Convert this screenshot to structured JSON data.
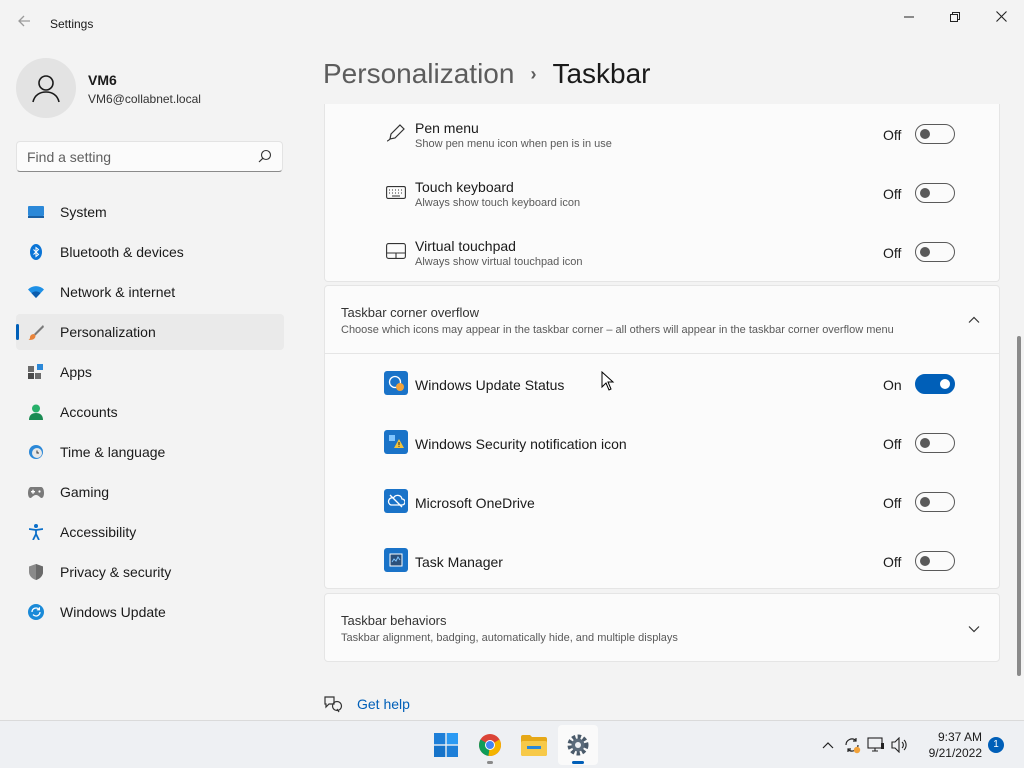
{
  "window": {
    "title": "Settings",
    "back_icon": "back-arrow-icon",
    "controls": [
      "minimize",
      "maximize",
      "close"
    ]
  },
  "profile": {
    "name": "VM6",
    "email": "VM6@collabnet.local"
  },
  "search": {
    "placeholder": "Find a setting"
  },
  "sidebar": {
    "items": [
      {
        "label": "System",
        "icon": "system-icon"
      },
      {
        "label": "Bluetooth & devices",
        "icon": "bluetooth-icon"
      },
      {
        "label": "Network & internet",
        "icon": "network-icon"
      },
      {
        "label": "Personalization",
        "icon": "personalization-icon",
        "selected": true
      },
      {
        "label": "Apps",
        "icon": "apps-icon"
      },
      {
        "label": "Accounts",
        "icon": "accounts-icon"
      },
      {
        "label": "Time & language",
        "icon": "time-language-icon"
      },
      {
        "label": "Gaming",
        "icon": "gaming-icon"
      },
      {
        "label": "Accessibility",
        "icon": "accessibility-icon"
      },
      {
        "label": "Privacy & security",
        "icon": "privacy-icon"
      },
      {
        "label": "Windows Update",
        "icon": "windows-update-icon"
      }
    ]
  },
  "breadcrumb": {
    "parent": "Personalization",
    "separator": "›",
    "current": "Taskbar"
  },
  "corner_icons": {
    "rows": [
      {
        "title": "Pen menu",
        "desc": "Show pen menu icon when pen is in use",
        "state": "Off",
        "on": false
      },
      {
        "title": "Touch keyboard",
        "desc": "Always show touch keyboard icon",
        "state": "Off",
        "on": false
      },
      {
        "title": "Virtual touchpad",
        "desc": "Always show virtual touchpad icon",
        "state": "Off",
        "on": false
      }
    ]
  },
  "overflow": {
    "title": "Taskbar corner overflow",
    "desc": "Choose which icons may appear in the taskbar corner – all others will appear in the taskbar corner overflow menu",
    "expanded": true,
    "rows": [
      {
        "title": "Windows Update Status",
        "state": "On",
        "on": true
      },
      {
        "title": "Windows Security notification icon",
        "state": "Off",
        "on": false
      },
      {
        "title": "Microsoft OneDrive",
        "state": "Off",
        "on": false
      },
      {
        "title": "Task Manager",
        "state": "Off",
        "on": false
      }
    ]
  },
  "behaviors": {
    "title": "Taskbar behaviors",
    "desc": "Taskbar alignment, badging, automatically hide, and multiple displays",
    "expanded": false
  },
  "help": {
    "label": "Get help"
  },
  "taskbar": {
    "apps": [
      "start-icon",
      "chrome-icon",
      "file-explorer-icon",
      "settings-icon"
    ],
    "active_app": "settings-icon",
    "time": "9:37 AM",
    "date": "9/21/2022",
    "notification_count": "1"
  },
  "colors": {
    "accent": "#005fb8",
    "background": "#f3f3f3",
    "card": "#fbfbfb"
  }
}
